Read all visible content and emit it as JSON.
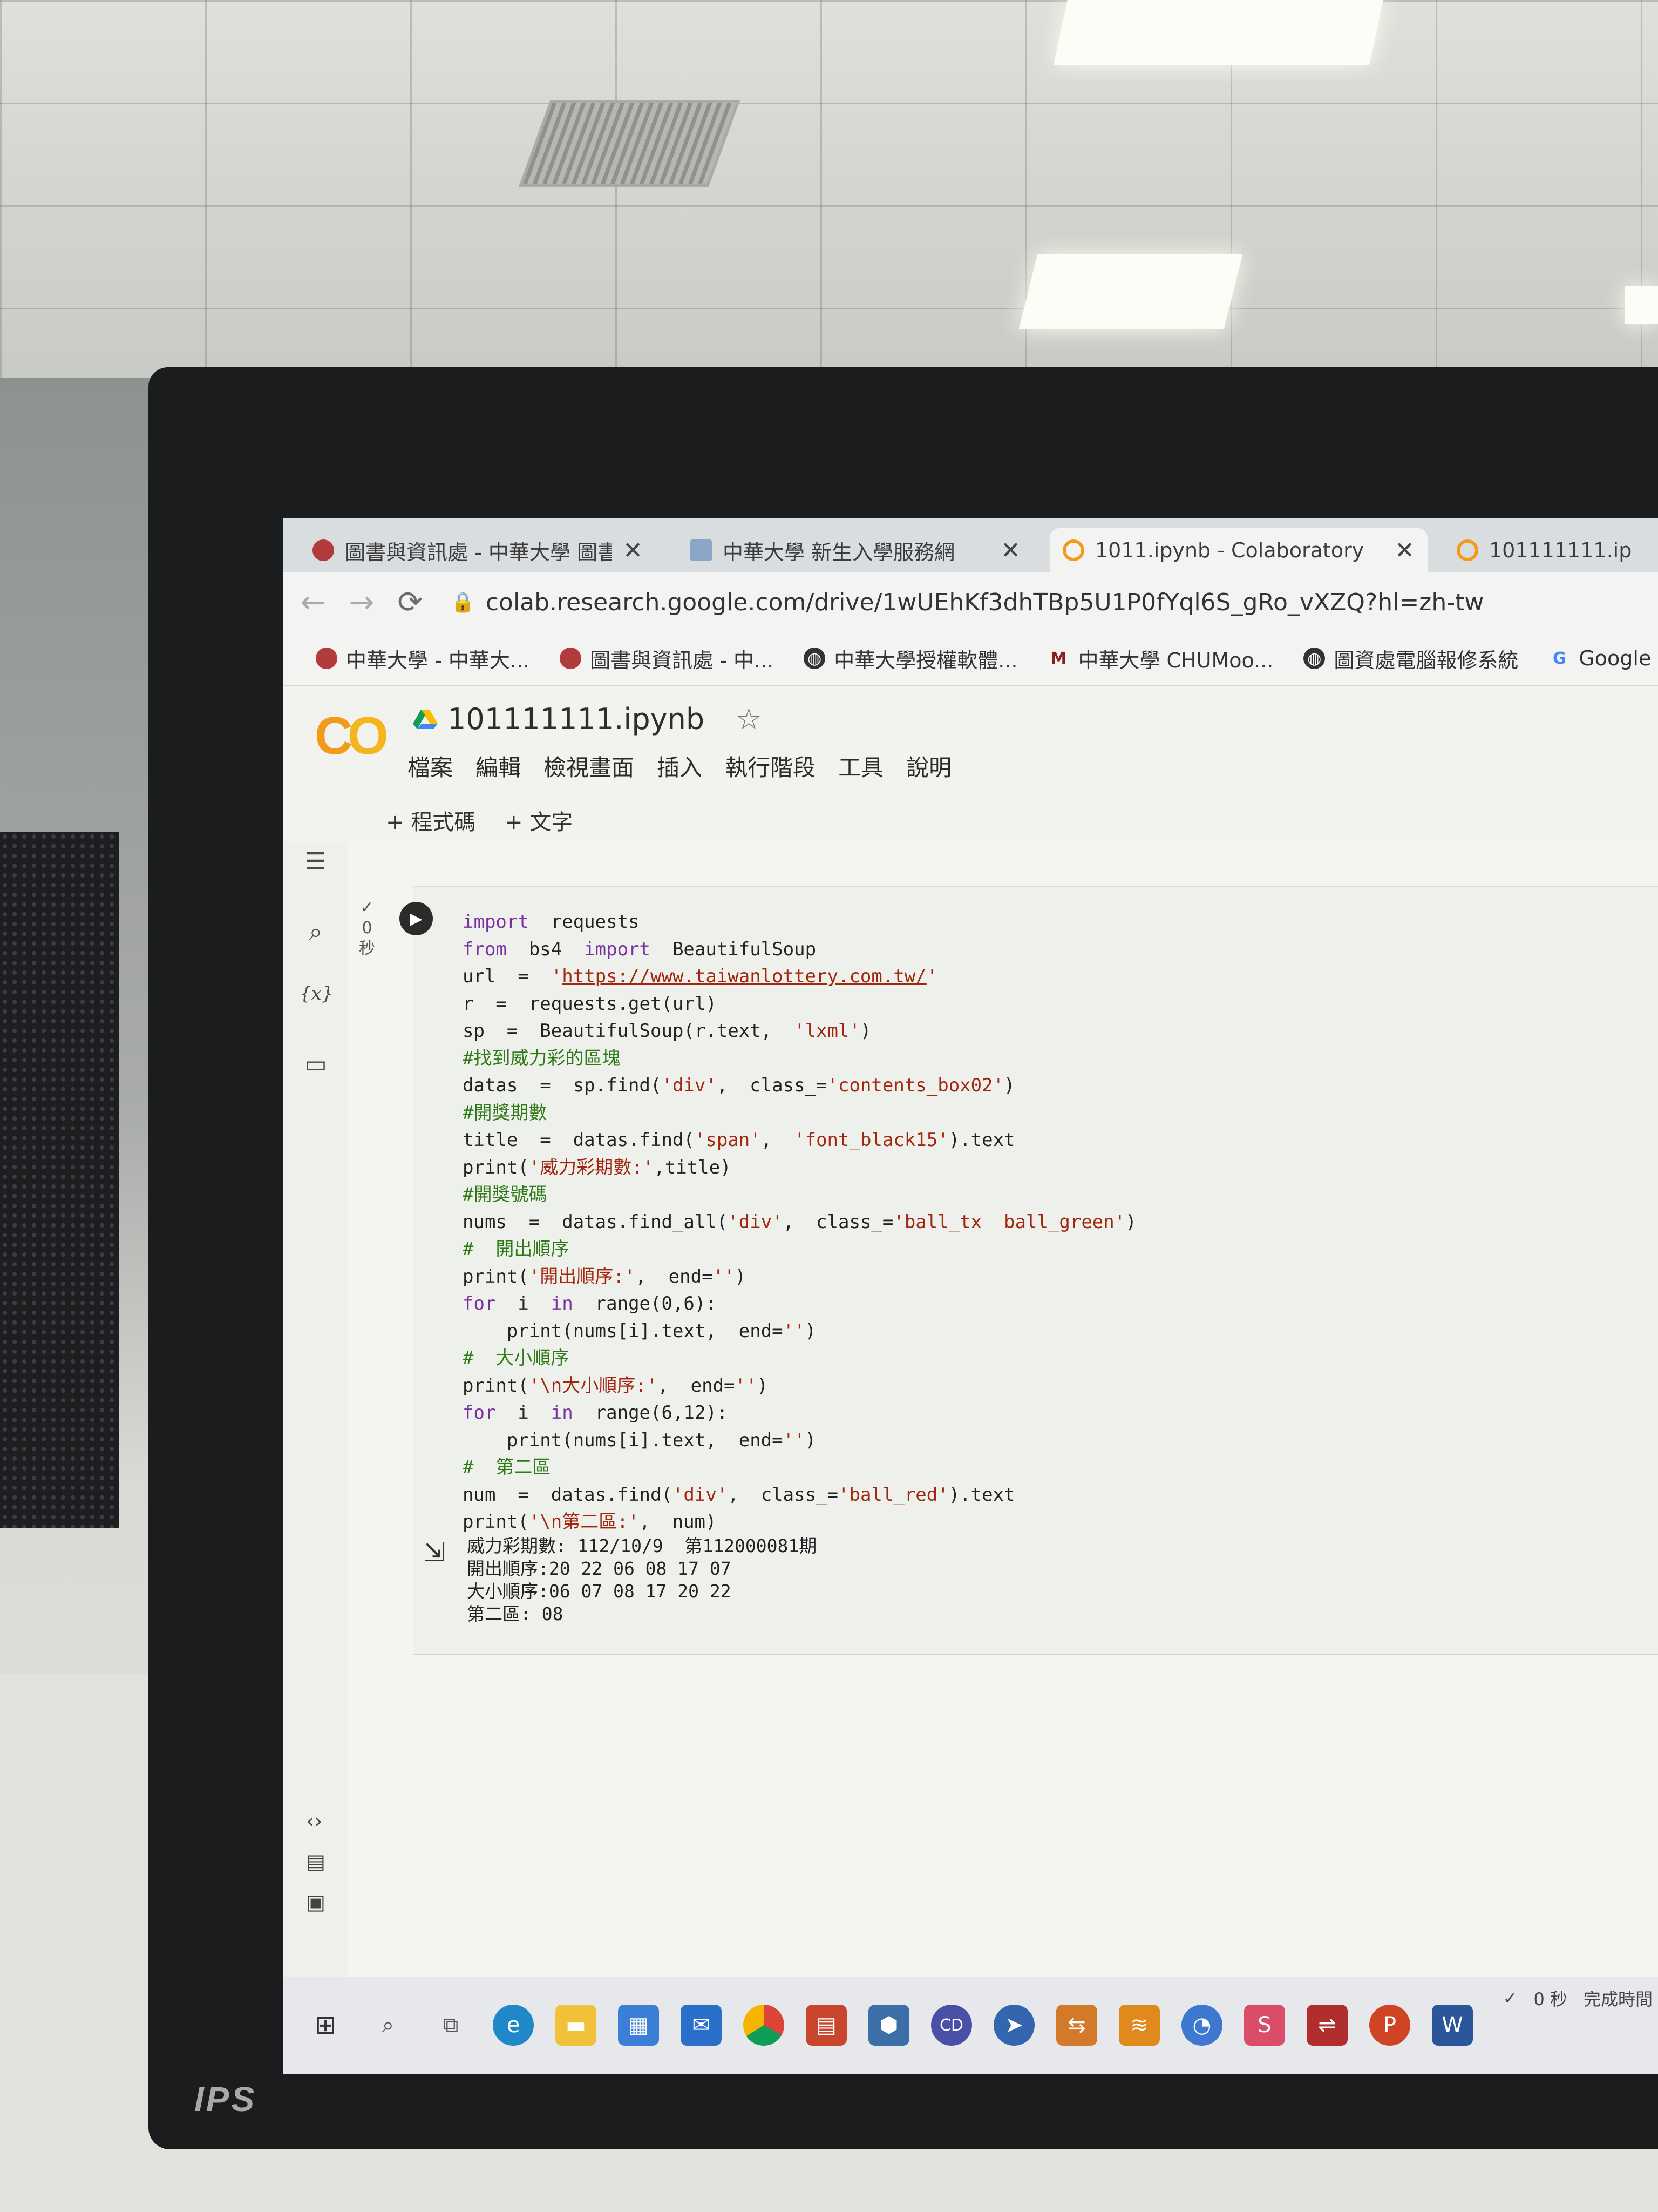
{
  "browser": {
    "tabs": [
      {
        "label": "圖書與資訊處 - 中華大學 圖書與",
        "close": "✕"
      },
      {
        "label": "中華大學 新生入學服務網",
        "close": "✕"
      },
      {
        "label": "1011.ipynb - Colaboratory",
        "close": "✕"
      },
      {
        "label": "101111111.ip",
        "close": ""
      }
    ],
    "url": "colab.research.google.com/drive/1wUEhKf3dhTBp5U1P0fYql6S_gRo_vXZQ?hl=zh-tw",
    "bookmarks": [
      {
        "label": "中華大學 - 中華大...",
        "icon": "university-seal-icon"
      },
      {
        "label": "圖書與資訊處 - 中...",
        "icon": "university-seal-icon"
      },
      {
        "label": "中華大學授權軟體...",
        "icon": "globe-icon"
      },
      {
        "label": "中華大學 CHUMoo...",
        "icon": "m-logo-icon"
      },
      {
        "label": "圖資處電腦報修系統",
        "icon": "globe-icon"
      },
      {
        "label": "Google",
        "icon": "google-g-icon"
      }
    ]
  },
  "colab": {
    "logo": "CO",
    "notebook_name": "101111111.ipynb",
    "menu": [
      "檔案",
      "編輯",
      "檢視畫面",
      "插入",
      "執行階段",
      "工具",
      "說明"
    ],
    "add_code": "+ 程式碼",
    "add_text": "+ 文字",
    "exec_check": "✓",
    "exec_time": "0",
    "exec_unit": "秒",
    "code_lines": [
      "import  requests",
      "from  bs4  import  BeautifulSoup",
      "url  =  'https://www.taiwanlottery.com.tw/'",
      "r  =  requests.get(url)",
      "sp  =  BeautifulSoup(r.text,  'lxml')",
      "#找到威力彩的區塊",
      "datas  =  sp.find('div',  class_='contents_box02')",
      "#開獎期數",
      "title  =  datas.find('span',  'font_black15').text",
      "print('威力彩期數:',title)",
      "#開獎號碼",
      "nums  =  datas.find_all('div',  class_='ball_tx  ball_green')",
      "#  開出順序",
      "print('開出順序:',  end='')",
      "for  i  in  range(0,6):",
      "    print(nums[i].text,  end='')",
      "#  大小順序",
      "print('\\n大小順序:',  end='')",
      "for  i  in  range(6,12):",
      "    print(nums[i].text,  end='')",
      "#  第二區",
      "num  =  datas.find('div',  class_='ball_red').text",
      "print('\\n第二區:',  num)"
    ],
    "output_lines": [
      "威力彩期數: 112/10/9  第112000081期",
      "開出順序:20 22 06 08 17 07",
      "大小順序:06 07 08 17 20 22",
      "第二區: 08"
    ]
  },
  "statusbar": {
    "check": "✓",
    "time": "0 秒",
    "label": "完成時間"
  },
  "monitor_brand": "IPS",
  "colors": {
    "colab_orange": "#f29b19",
    "keyword": "#7a2fa0",
    "string": "#a1260d",
    "comment": "#2f7a16"
  }
}
